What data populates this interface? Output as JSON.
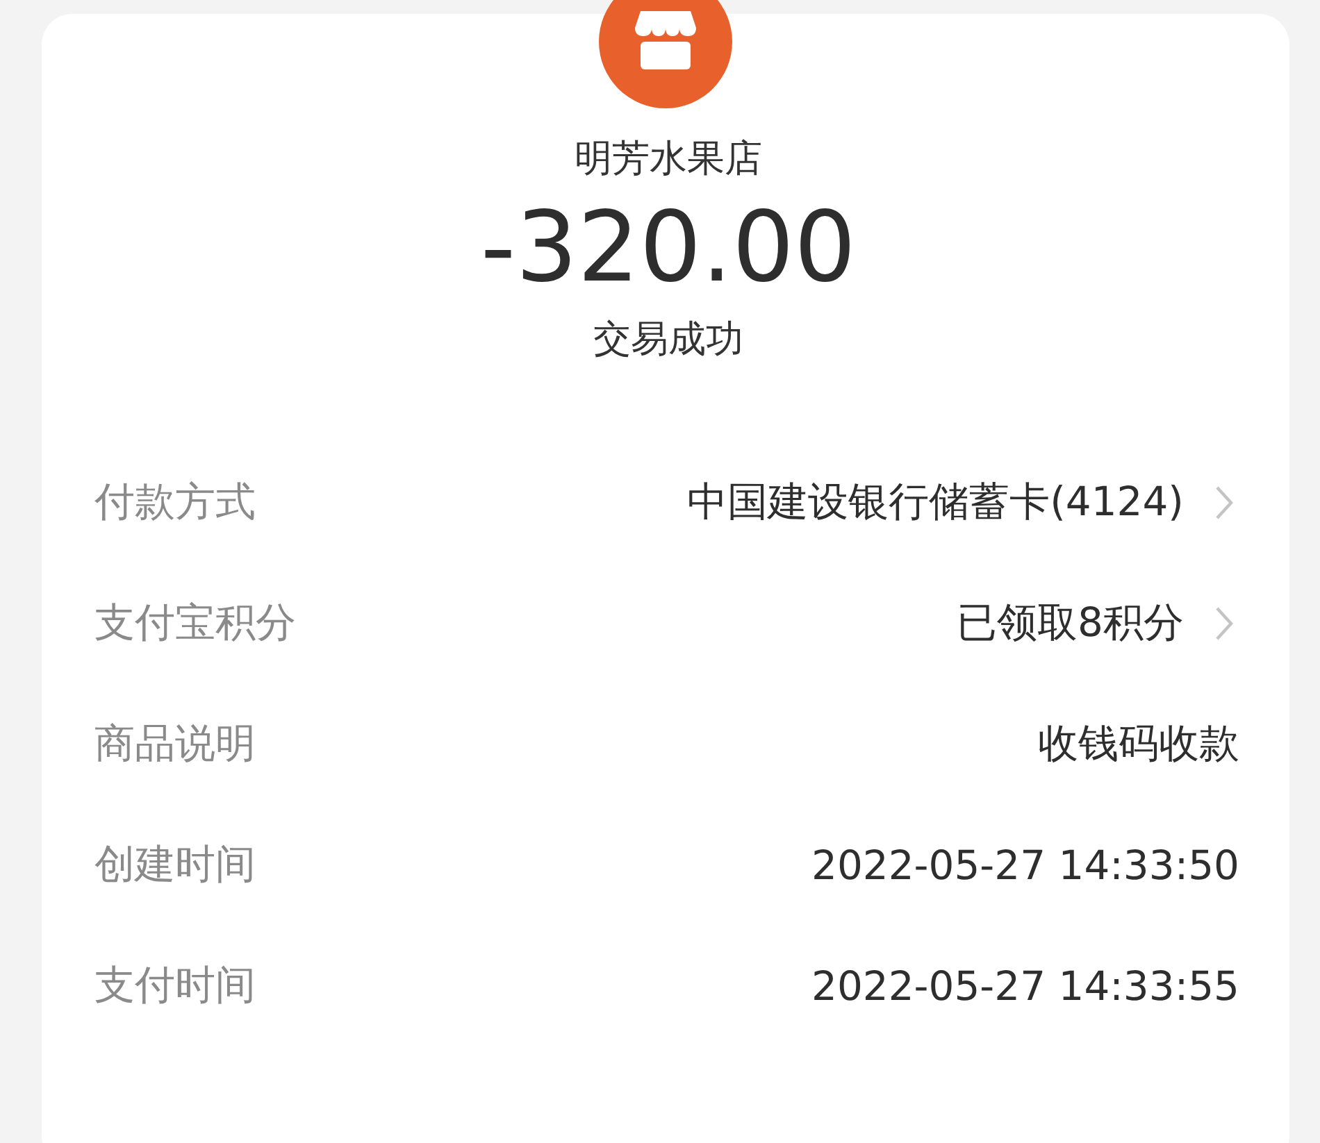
{
  "merchant": {
    "name": "明芳水果店"
  },
  "amount": "-320.00",
  "status": "交易成功",
  "details": [
    {
      "label": "付款方式",
      "value": "中国建设银行储蓄卡(4124)",
      "kind": "link"
    },
    {
      "label": "支付宝积分",
      "value": "已领取8积分",
      "kind": "link"
    },
    {
      "label": "商品说明",
      "value": "收钱码收款",
      "kind": "plain"
    },
    {
      "label": "创建时间",
      "value": "2022-05-27 14:33:50",
      "kind": "plain"
    },
    {
      "label": "支付时间",
      "value": "2022-05-27 14:33:55",
      "kind": "plain"
    }
  ]
}
